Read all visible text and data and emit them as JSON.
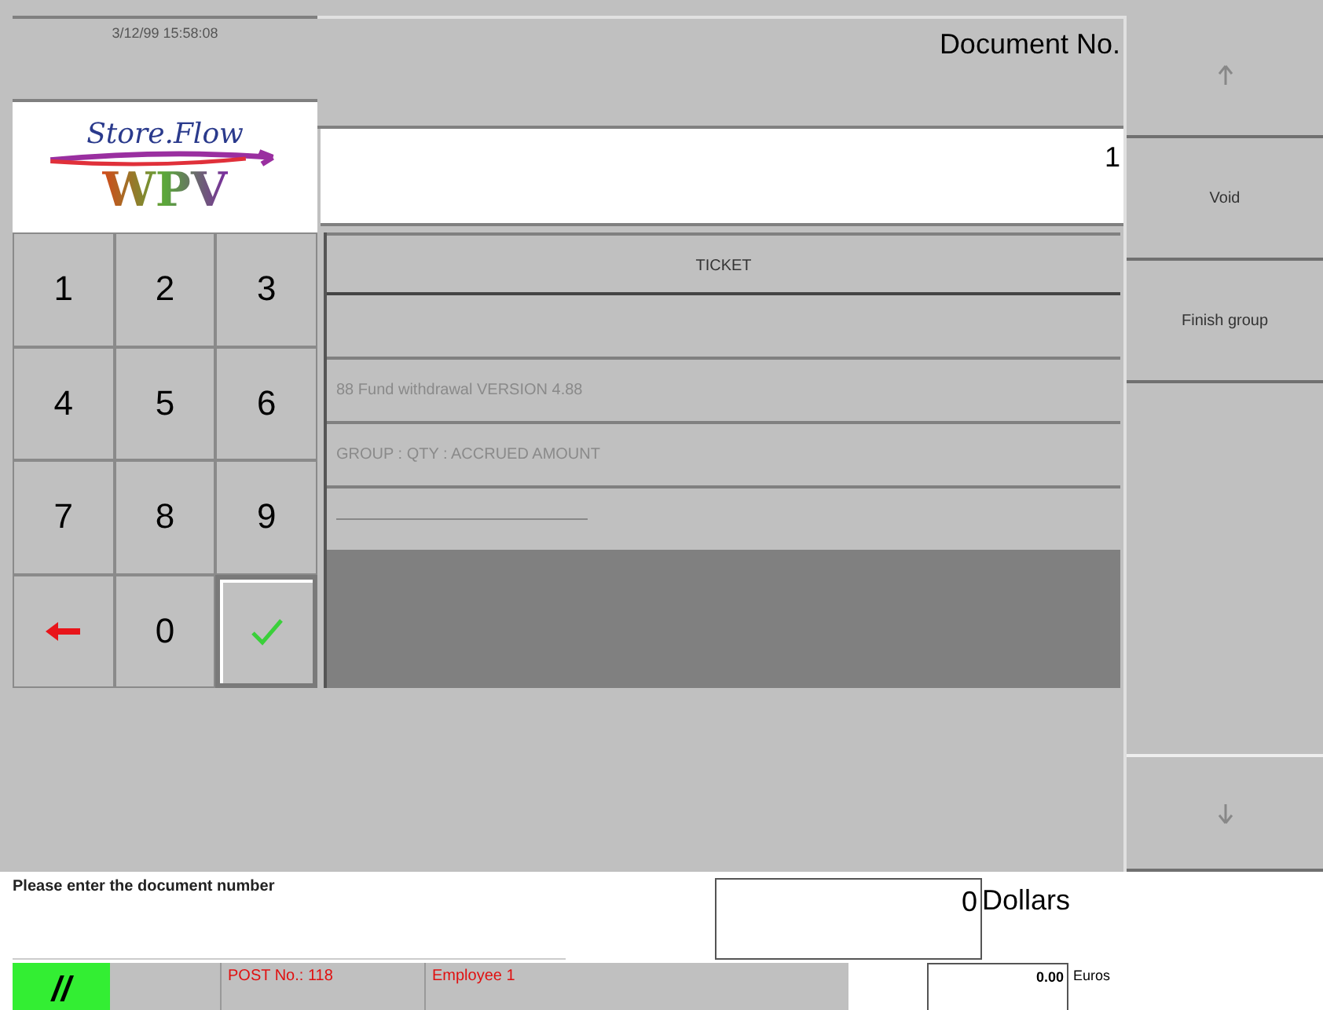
{
  "clock": "3/12/99  15:58:08",
  "logo": {
    "top": "Store.Flow",
    "bottom": "WPV"
  },
  "document": {
    "label": "Document No.",
    "value": "1"
  },
  "keypad": [
    {
      "kind": "digit",
      "label": "1",
      "selected": false
    },
    {
      "kind": "digit",
      "label": "2",
      "selected": false
    },
    {
      "kind": "digit",
      "label": "3",
      "selected": false
    },
    {
      "kind": "digit",
      "label": "4",
      "selected": false
    },
    {
      "kind": "digit",
      "label": "5",
      "selected": false
    },
    {
      "kind": "digit",
      "label": "6",
      "selected": false
    },
    {
      "kind": "digit",
      "label": "7",
      "selected": false
    },
    {
      "kind": "digit",
      "label": "8",
      "selected": false
    },
    {
      "kind": "digit",
      "label": "9",
      "selected": false
    },
    {
      "kind": "back",
      "selected": false
    },
    {
      "kind": "digit",
      "label": "0",
      "selected": false
    },
    {
      "kind": "enter",
      "selected": true
    }
  ],
  "ticket": {
    "title": "TICKET",
    "lines": [
      {
        "kind": "blank"
      },
      {
        "kind": "text",
        "text": "88 Fund withdrawal  VERSION 4.88"
      },
      {
        "kind": "text",
        "text": "GROUP :  QTY :  ACCRUED AMOUNT"
      },
      {
        "kind": "rule"
      }
    ]
  },
  "side_buttons": [
    {
      "kind": "up"
    },
    {
      "kind": "text",
      "label": "Void"
    },
    {
      "kind": "text",
      "label": "Finish group"
    }
  ],
  "message": "Please enter the document number",
  "amount": {
    "value": "0",
    "currency": "Dollars"
  },
  "status": {
    "indicator": "//",
    "post": "POST No.: 118",
    "employee": "Employee 1",
    "euro_value": "0.00",
    "euro_label": "Euros"
  }
}
